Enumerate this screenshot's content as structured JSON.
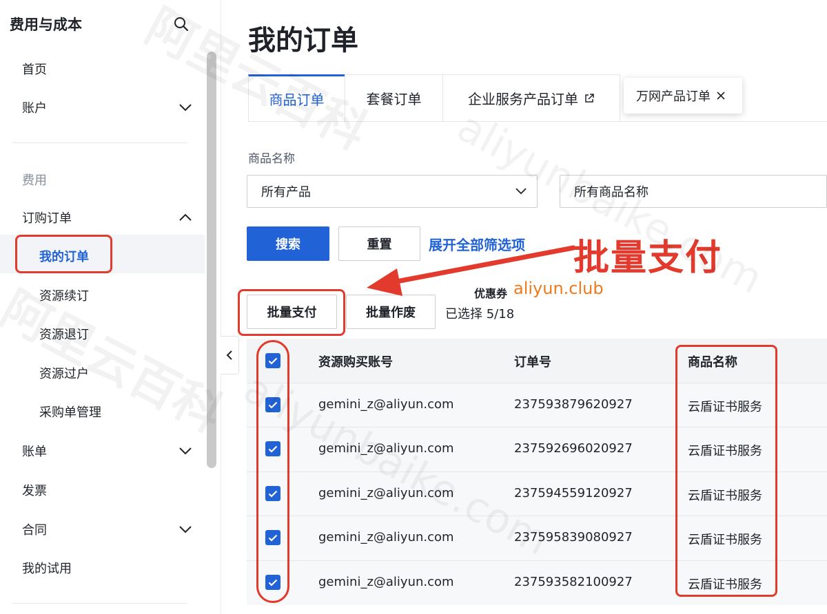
{
  "sidebar": {
    "title": "费用与成本",
    "items": [
      {
        "label": "首页"
      },
      {
        "label": "账户"
      },
      {
        "label": "费用"
      },
      {
        "label": "订购订单"
      },
      {
        "label": "我的订单"
      },
      {
        "label": "资源续订"
      },
      {
        "label": "资源退订"
      },
      {
        "label": "资源过户"
      },
      {
        "label": "采购单管理"
      },
      {
        "label": "账单"
      },
      {
        "label": "发票"
      },
      {
        "label": "合同"
      },
      {
        "label": "我的试用"
      }
    ]
  },
  "page": {
    "title": "我的订单",
    "tabs": [
      {
        "label": "商品订单"
      },
      {
        "label": "套餐订单"
      },
      {
        "label": "企业服务产品订单"
      },
      {
        "label": "万网产品订单"
      }
    ]
  },
  "filters": {
    "label": "商品名称",
    "product_select": "所有产品",
    "name_select": "所有商品名称"
  },
  "actions": {
    "search": "搜索",
    "reset": "重置",
    "expand_filters": "展开全部筛选项",
    "batch_pay": "批量支付",
    "batch_void": "批量作废",
    "selected": "已选择 5/18"
  },
  "table": {
    "columns": [
      "资源购买账号",
      "订单号",
      "商品名称"
    ],
    "rows": [
      {
        "account": "gemini_z@aliyun.com",
        "order_no": "237593879620927",
        "product": "云盾证书服务",
        "checked": true
      },
      {
        "account": "gemini_z@aliyun.com",
        "order_no": "237592696020927",
        "product": "云盾证书服务",
        "checked": true
      },
      {
        "account": "gemini_z@aliyun.com",
        "order_no": "237594559120927",
        "product": "云盾证书服务",
        "checked": true
      },
      {
        "account": "gemini_z@aliyun.com",
        "order_no": "237595839080927",
        "product": "云盾证书服务",
        "checked": true
      },
      {
        "account": "gemini_z@aliyun.com",
        "order_no": "237593582100927",
        "product": "云盾证书服务",
        "checked": true
      }
    ]
  },
  "annotations": {
    "callout": "批量支付",
    "coupon_label": "优惠券",
    "coupon_url": "aliyun.club",
    "watermark_cn": "阿里云百科",
    "watermark_en": "aliyunbaike.com"
  },
  "colors": {
    "accent": "#2163d6",
    "annotation_red": "#e23b2e",
    "coupon_orange": "#f07a1a"
  }
}
